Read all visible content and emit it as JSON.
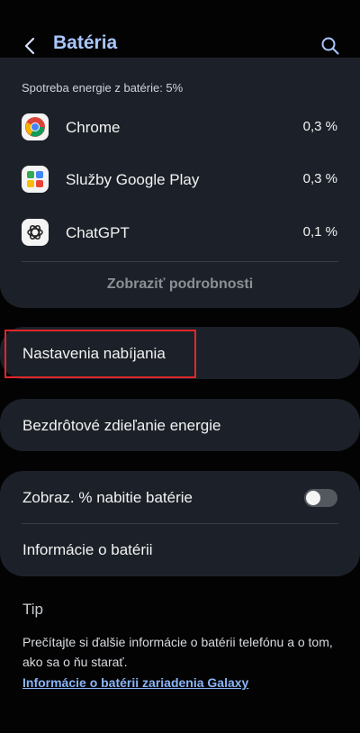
{
  "header": {
    "title": "Batéria",
    "back_icon": "back-arrow-icon",
    "search_icon": "search-icon"
  },
  "usage": {
    "summary": "Spotreba energie z batérie: 5%",
    "apps": [
      {
        "name": "Chrome",
        "percent": "0,3 %",
        "icon": "chrome-icon"
      },
      {
        "name": "Služby Google Play",
        "percent": "0,3 %",
        "icon": "google-play-services-icon"
      },
      {
        "name": "ChatGPT",
        "percent": "0,1 %",
        "icon": "chatgpt-icon"
      }
    ],
    "details_label": "Zobraziť podrobnosti"
  },
  "settings": {
    "charging_label": "Nastavenia nabíjania",
    "wireless_label": "Bezdrôtové zdieľanie energie",
    "show_percent_label": "Zobraz. % nabitie batérie",
    "show_percent_enabled": false,
    "battery_info_label": "Informácie o batérii"
  },
  "tip": {
    "title": "Tip",
    "text": "Prečítajte si ďalšie informácie o batérii telefónu a o tom, ako sa o ňu starať.",
    "link": "Informácie o batérii zariadenia Galaxy"
  },
  "colors": {
    "background": "#030303",
    "card": "#1c2129",
    "accent": "#a9c7ff",
    "link": "#8ab4f8",
    "highlight": "#e0262b"
  }
}
